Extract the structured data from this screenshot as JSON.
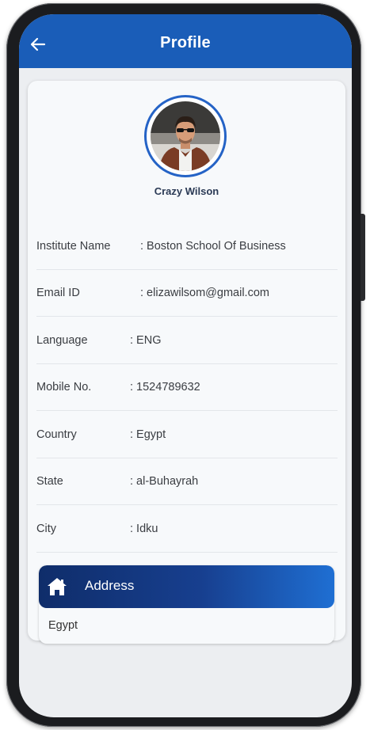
{
  "header": {
    "title": "Profile",
    "back_icon": "arrow-left-icon"
  },
  "profile": {
    "name": "Crazy Wilson",
    "avatar": "profile-photo"
  },
  "fields": [
    {
      "label": "Institute Name",
      "value": ": Boston School Of Business"
    },
    {
      "label": "Email ID",
      "value": ": elizawilsom@gmail.com"
    },
    {
      "label": "Language",
      "value": ": ENG"
    },
    {
      "label": "Mobile No.",
      "value": ": 1524789632"
    },
    {
      "label": "Country",
      "value": ": Egypt"
    },
    {
      "label": "State",
      "value": ": al-Buhayrah"
    },
    {
      "label": "City",
      "value": ": Idku"
    }
  ],
  "address": {
    "title": "Address",
    "icon": "home-icon",
    "value": "Egypt"
  },
  "colors": {
    "primary": "#1a5db8",
    "gradient_dark": "#0f2d6a",
    "gradient_light": "#1f6fd3"
  }
}
